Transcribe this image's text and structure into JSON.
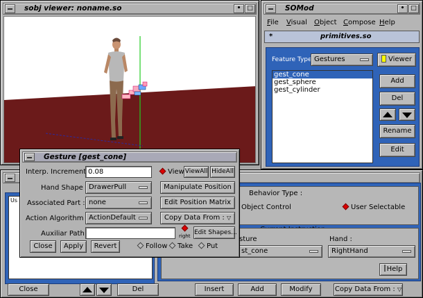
{
  "viewer": {
    "title": "sobj viewer: noname.so"
  },
  "somod": {
    "title": "SOMod",
    "menu": [
      "File",
      "Visual",
      "Object",
      "Compose",
      "Help"
    ],
    "file_label": "primitives.so",
    "file_marker": "*",
    "feature_type_label": "Feature Type",
    "feature_type_value": "Gestures",
    "viewer_button": "Viewer",
    "list_items": [
      "gest_cone",
      "gest_sphere",
      "gest_cylinder"
    ],
    "selected_index": 0,
    "add_button": "Add",
    "del_button": "Del",
    "rename_button": "Rename",
    "edit_button": "Edit"
  },
  "behavior": {
    "behavior_type_label": "Behavior Type :",
    "option_object_control": "Object Control",
    "option_user_selectable": "User Selectable",
    "current_instruction_label": "Current Instruction :",
    "gesture_label": "sture",
    "gesture_value": "st_cone",
    "hand_label": "Hand :",
    "hand_value": "RightHand",
    "help_button": "Help",
    "list_header": "Us",
    "bottom": {
      "close": "Close",
      "del": "Del",
      "insert": "Insert",
      "add": "Add",
      "modify": "Modify",
      "copy_data_from": "Copy Data From :"
    }
  },
  "gesture_dialog": {
    "title": "Gesture [gest_cone]",
    "interp_label": "Interp. Increment :",
    "interp_value": "0.08",
    "view_label": "View",
    "viewall_button": "ViewAll",
    "hideall_button": "HideAll",
    "hand_shape_label": "Hand Shape :",
    "hand_shape_value": "DrawerPull",
    "manipulate_button": "Manipulate Position",
    "assoc_part_label": "Associated Part :",
    "assoc_part_value": "none",
    "edit_matrix_button": "Edit Position Matrix",
    "action_algo_label": "Action Algorithm :",
    "action_algo_value": "ActionDefault",
    "copy_data_from": "Copy Data From :",
    "auxiliar_label": "Auxiliar Path :",
    "auxiliar_value": "",
    "right_label": "right",
    "edit_shapes_button": "Edit Shapes...",
    "close_button": "Close",
    "apply_button": "Apply",
    "revert_button": "Revert",
    "follow_label": "Follow",
    "take_label": "Take",
    "put_label": "Put"
  },
  "colors": {
    "viewport_bg": "#ffffff",
    "floor": "#6b1a1a",
    "blue_panel": "#2f63b8",
    "selection": "#2f63b8"
  }
}
